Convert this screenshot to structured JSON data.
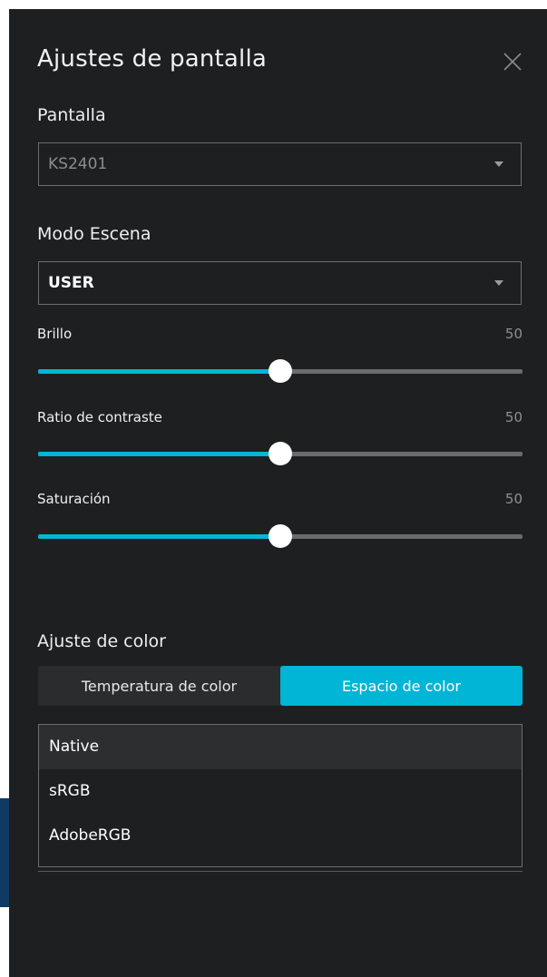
{
  "dialog": {
    "title": "Ajustes de pantalla",
    "close_icon": "close-icon"
  },
  "display": {
    "label": "Pantalla",
    "value": "KS2401"
  },
  "scene_mode": {
    "label": "Modo Escena",
    "value": "USER"
  },
  "sliders": [
    {
      "label": "Brillo",
      "value": "50",
      "fraction": 0.5
    },
    {
      "label": "Ratio de contraste",
      "value": "50",
      "fraction": 0.5
    },
    {
      "label": "Saturación",
      "value": "50",
      "fraction": 0.5
    }
  ],
  "color_adjust": {
    "label": "Ajuste de color",
    "tabs": [
      {
        "label": "Temperatura de color",
        "selected": false
      },
      {
        "label": "Espacio de color",
        "selected": true
      }
    ],
    "options": [
      "Native",
      "sRGB",
      "AdobeRGB"
    ],
    "highlighted_option": "Native"
  },
  "colors": {
    "panel_bg": "#1e1f21",
    "accent": "#00b5d6",
    "track": "#6a6b6d",
    "border": "#6d6e70"
  }
}
